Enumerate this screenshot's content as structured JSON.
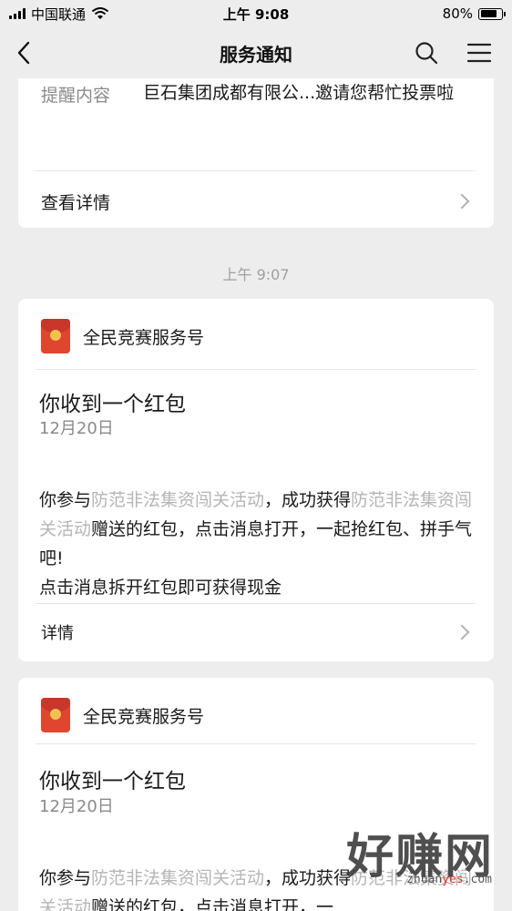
{
  "status_bar": {
    "carrier": "中国联通",
    "time": "上午 9:08",
    "battery": "80%",
    "battery_level": 0.8
  },
  "nav": {
    "title": "服务通知",
    "back_icon": "back-chevron-icon",
    "search_icon": "search-icon",
    "menu_icon": "menu-icon"
  },
  "notice_card": {
    "key": "提醒内容",
    "value": "巨石集团成都有限公...邀请您帮忙投票啦",
    "detail_label": "查看详情"
  },
  "time_separator": "上午 9:07",
  "messages": [
    {
      "sender": "全民竞赛服务号",
      "title": "你收到一个红包",
      "date": "12月20日",
      "body_1": "你参与",
      "body_link_1": "防范非法集资闯关活动",
      "body_2": "，成功获得",
      "body_link_2": "防范非法集资闯关活动",
      "body_3": "赠送的红包，点击消息打开，一起抢红包、拼手气吧!",
      "body_4": "点击消息拆开红包即可获得现金",
      "detail_label": "详情"
    },
    {
      "sender": "全民竞赛服务号",
      "title": "你收到一个红包",
      "date": "12月20日",
      "body_1": "你参与",
      "body_link_1": "防范非法集资闯关活动",
      "body_2": "，成功获得",
      "body_link_2": "防范非法集资闯关活动",
      "body_3": "赠送的红包，点击消息打开，一",
      "body_4": ""
    }
  ],
  "watermark": {
    "brand": "好赚网",
    "domain_prefix": "zhuan",
    "domain_highlight": "yes",
    "domain_suffix": ".com"
  }
}
